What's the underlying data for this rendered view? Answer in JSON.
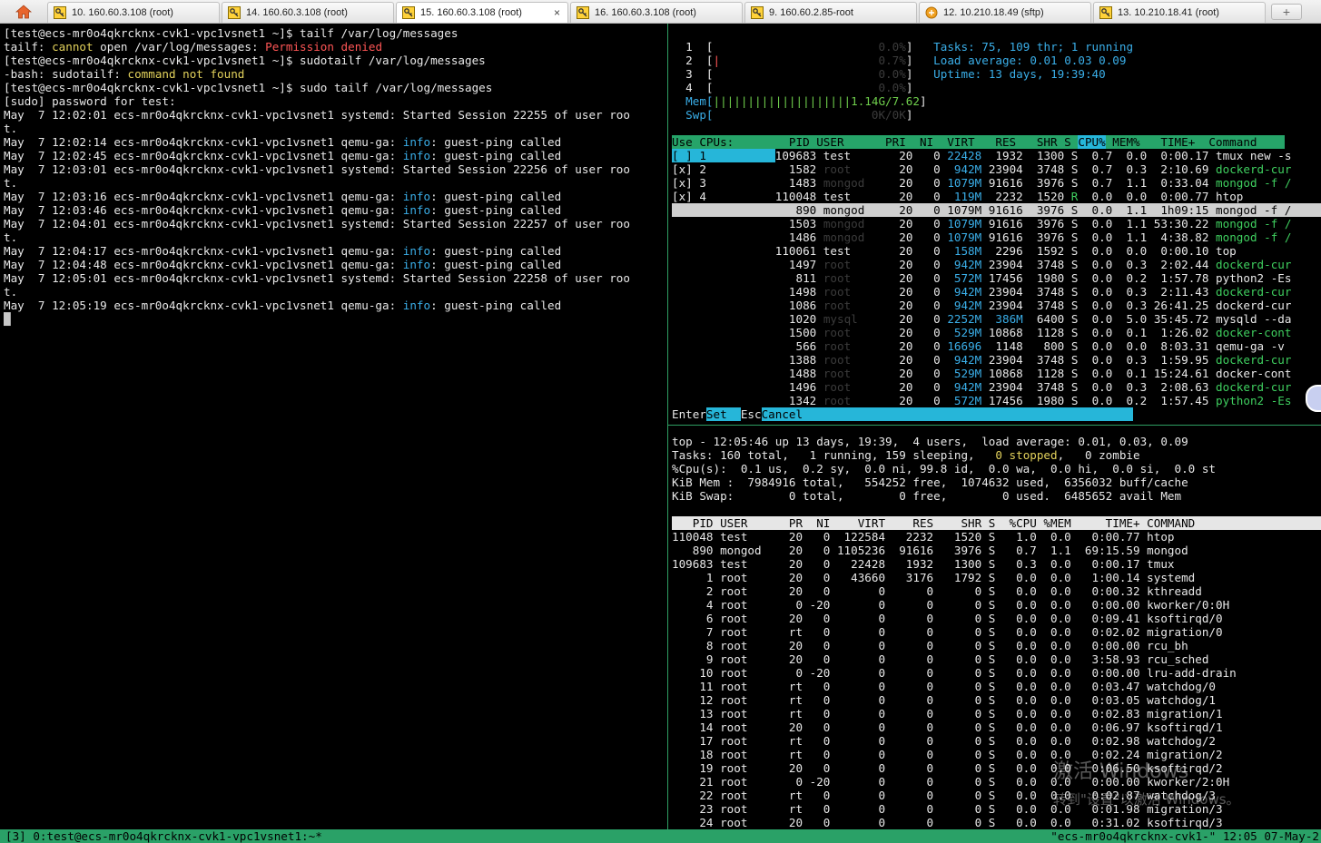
{
  "tabs": [
    {
      "label": "10. 160.60.3.108 (root)",
      "icon": "key-icon",
      "active": false
    },
    {
      "label": "14. 160.60.3.108 (root)",
      "icon": "key-icon",
      "active": false
    },
    {
      "label": "15. 160.60.3.108 (root)",
      "icon": "key-icon",
      "active": true
    },
    {
      "label": "16. 160.60.3.108 (root)",
      "icon": "key-icon",
      "active": false
    },
    {
      "label": "9. 160.60.2.85-root",
      "icon": "key-icon",
      "active": false
    },
    {
      "label": "12. 10.210.18.49 (sftp)",
      "icon": "sftp-icon",
      "active": false
    },
    {
      "label": "13. 10.210.18.41 (root)",
      "icon": "key-icon",
      "active": false
    }
  ],
  "tab_close": "×",
  "new_tab": "+",
  "left_pane": [
    [
      [
        "[test@ecs-mr0o4qkrcknx-cvk1-vpc1vsnet1 ~]$ tailf /var/log/messages",
        ""
      ]
    ],
    [
      [
        "tailf: ",
        ""
      ],
      [
        "cannot",
        "y"
      ],
      [
        " open /var/log/messages: ",
        ""
      ],
      [
        "Permission denied",
        "r"
      ]
    ],
    [
      [
        "[test@ecs-mr0o4qkrcknx-cvk1-vpc1vsnet1 ~]$ sudotailf /var/log/messages",
        ""
      ]
    ],
    [
      [
        "-bash: sudotailf: ",
        ""
      ],
      [
        "command not found",
        "y"
      ]
    ],
    [
      [
        "[test@ecs-mr0o4qkrcknx-cvk1-vpc1vsnet1 ~]$ sudo tailf /var/log/messages",
        ""
      ]
    ],
    [
      [
        "[sudo] password for test:",
        ""
      ]
    ],
    [
      [
        "May  7 12:02:01 ecs-mr0o4qkrcknx-cvk1-vpc1vsnet1 systemd: Started Session 22255 of user roo",
        ""
      ]
    ],
    [
      [
        "t.",
        ""
      ]
    ],
    [
      [
        "May  7 12:02:14 ecs-mr0o4qkrcknx-cvk1-vpc1vsnet1 qemu-ga: ",
        ""
      ],
      [
        "info",
        "c"
      ],
      [
        ": guest-ping called",
        ""
      ]
    ],
    [
      [
        "May  7 12:02:45 ecs-mr0o4qkrcknx-cvk1-vpc1vsnet1 qemu-ga: ",
        ""
      ],
      [
        "info",
        "c"
      ],
      [
        ": guest-ping called",
        ""
      ]
    ],
    [
      [
        "May  7 12:03:01 ecs-mr0o4qkrcknx-cvk1-vpc1vsnet1 systemd: Started Session 22256 of user roo",
        ""
      ]
    ],
    [
      [
        "t.",
        ""
      ]
    ],
    [
      [
        "May  7 12:03:16 ecs-mr0o4qkrcknx-cvk1-vpc1vsnet1 qemu-ga: ",
        ""
      ],
      [
        "info",
        "c"
      ],
      [
        ": guest-ping called",
        ""
      ]
    ],
    [
      [
        "May  7 12:03:46 ecs-mr0o4qkrcknx-cvk1-vpc1vsnet1 qemu-ga: ",
        ""
      ],
      [
        "info",
        "c"
      ],
      [
        ": guest-ping called",
        ""
      ]
    ],
    [
      [
        "May  7 12:04:01 ecs-mr0o4qkrcknx-cvk1-vpc1vsnet1 systemd: Started Session 22257 of user roo",
        ""
      ]
    ],
    [
      [
        "t.",
        ""
      ]
    ],
    [
      [
        "May  7 12:04:17 ecs-mr0o4qkrcknx-cvk1-vpc1vsnet1 qemu-ga: ",
        ""
      ],
      [
        "info",
        "c"
      ],
      [
        ": guest-ping called",
        ""
      ]
    ],
    [
      [
        "May  7 12:04:48 ecs-mr0o4qkrcknx-cvk1-vpc1vsnet1 qemu-ga: ",
        ""
      ],
      [
        "info",
        "c"
      ],
      [
        ": guest-ping called",
        ""
      ]
    ],
    [
      [
        "May  7 12:05:01 ecs-mr0o4qkrcknx-cvk1-vpc1vsnet1 systemd: Started Session 22258 of user roo",
        ""
      ]
    ],
    [
      [
        "t.",
        ""
      ]
    ],
    [
      [
        "May  7 12:05:19 ecs-mr0o4qkrcknx-cvk1-vpc1vsnet1 qemu-ga: ",
        ""
      ],
      [
        "info",
        "c"
      ],
      [
        ": guest-ping called",
        ""
      ]
    ],
    [
      [
        "█",
        "dg2"
      ]
    ]
  ],
  "htop_pane": [
    [
      [
        "  1  [",
        ""
      ],
      [
        "                        0.0%",
        "dg"
      ],
      [
        "]   ",
        ""
      ],
      [
        "Tasks: ",
        "c"
      ],
      [
        "75",
        "c"
      ],
      [
        ", 109 thr; 1 running",
        "c"
      ]
    ],
    [
      [
        "  2  [",
        ""
      ],
      [
        "|",
        "r"
      ],
      [
        "                       0.7%",
        "dg"
      ],
      [
        "]   ",
        ""
      ],
      [
        "Load average: ",
        "c"
      ],
      [
        "0.01 0.03 0.09",
        "c"
      ]
    ],
    [
      [
        "  3  [",
        ""
      ],
      [
        "                        0.0%",
        "dg"
      ],
      [
        "]   ",
        ""
      ],
      [
        "Uptime: ",
        "c"
      ],
      [
        "13 days, 19:39:40",
        "c"
      ]
    ],
    [
      [
        "  4  [",
        ""
      ],
      [
        "                        0.0%",
        "dg"
      ],
      [
        "]",
        ""
      ]
    ],
    [
      [
        "  Mem[",
        "c"
      ],
      [
        "||||||||||||||||||||1.14G/7.62",
        "g"
      ],
      [
        "]",
        ""
      ]
    ],
    [
      [
        "  Swp[",
        "c"
      ],
      [
        "                       0K/0K",
        "dg"
      ],
      [
        "]",
        ""
      ]
    ],
    [
      [
        "",
        ""
      ]
    ],
    [
      [
        "Use CPUs:      ",
        "hdr"
      ],
      [
        "  PID USER      PRI  NI  VIRT   RES   SHR S ",
        "hdr"
      ],
      [
        "CPU%",
        "cyanbar"
      ],
      [
        " MEM%   TIME+  Command    ",
        "hdr"
      ]
    ],
    [
      [
        "[ ] 1          ",
        "cyanbar"
      ],
      [
        "109683 test       20   0 ",
        ""
      ],
      [
        "22428",
        "c"
      ],
      [
        "  1932  1300 S  0.7  0.0  0:00.17 tmux new -s",
        ""
      ]
    ],
    [
      [
        "[x] 2            ",
        ""
      ],
      [
        "1582 ",
        ""
      ],
      [
        "root     ",
        "dg"
      ],
      [
        "  20   0  ",
        ""
      ],
      [
        "942M",
        "c"
      ],
      [
        " 23904  3748 S  0.7  0.3  2:10.69 ",
        ""
      ],
      [
        "dockerd-cur",
        "gg"
      ]
    ],
    [
      [
        "[x] 3            ",
        ""
      ],
      [
        "1483 ",
        ""
      ],
      [
        "mongod   ",
        "dg"
      ],
      [
        "  20   0 ",
        ""
      ],
      [
        "1079M",
        "c"
      ],
      [
        " 91616  3976 S  0.7  1.1  0:33.04 ",
        ""
      ],
      [
        "mongod -f /",
        "gg"
      ]
    ],
    [
      [
        "[x] 4          ",
        ""
      ],
      [
        "110048 test       20   0  ",
        ""
      ],
      [
        "119M",
        "c"
      ],
      [
        "  2232  1520 ",
        ""
      ],
      [
        "R",
        "gg"
      ],
      [
        "  0.0  0.0  0:00.77 htop",
        ""
      ]
    ],
    [
      [
        "               ",
        ""
      ],
      [
        "   890 mongod     20   0 1079M 91616  3976 S  0.0  1.1  1h09:15 mongod -f /",
        "sel"
      ]
    ],
    [
      [
        "                 ",
        ""
      ],
      [
        "1503 ",
        ""
      ],
      [
        "mongod   ",
        "dg"
      ],
      [
        "  20   0 ",
        ""
      ],
      [
        "1079M",
        "c"
      ],
      [
        " 91616  3976 S  0.0  1.1 53:30.22 ",
        ""
      ],
      [
        "mongod -f /",
        "gg"
      ]
    ],
    [
      [
        "                 ",
        ""
      ],
      [
        "1486 ",
        ""
      ],
      [
        "mongod   ",
        "dg"
      ],
      [
        "  20   0 ",
        ""
      ],
      [
        "1079M",
        "c"
      ],
      [
        " 91616  3976 S  0.0  1.1  4:38.82 ",
        ""
      ],
      [
        "mongod -f /",
        "gg"
      ]
    ],
    [
      [
        "               ",
        ""
      ],
      [
        "110061 test       20   0  ",
        ""
      ],
      [
        "158M",
        "c"
      ],
      [
        "  2296  1592 S  0.0  0.0  0:00.10 top",
        ""
      ]
    ],
    [
      [
        "                 ",
        ""
      ],
      [
        "1497 ",
        ""
      ],
      [
        "root     ",
        "dg"
      ],
      [
        "  20   0  ",
        ""
      ],
      [
        "942M",
        "c"
      ],
      [
        " 23904  3748 S  0.0  0.3  2:02.44 ",
        ""
      ],
      [
        "dockerd-cur",
        "gg"
      ]
    ],
    [
      [
        "                  ",
        ""
      ],
      [
        "811 ",
        ""
      ],
      [
        "root     ",
        "dg"
      ],
      [
        "  20   0  ",
        ""
      ],
      [
        "572M",
        "c"
      ],
      [
        " 17456  1980 S  0.0  0.2  1:57.78 python2 -Es",
        ""
      ]
    ],
    [
      [
        "                 ",
        ""
      ],
      [
        "1498 ",
        ""
      ],
      [
        "root     ",
        "dg"
      ],
      [
        "  20   0  ",
        ""
      ],
      [
        "942M",
        "c"
      ],
      [
        " 23904  3748 S  0.0  0.3  2:11.43 ",
        ""
      ],
      [
        "dockerd-cur",
        "gg"
      ]
    ],
    [
      [
        "                 ",
        ""
      ],
      [
        "1086 ",
        ""
      ],
      [
        "root     ",
        "dg"
      ],
      [
        "  20   0  ",
        ""
      ],
      [
        "942M",
        "c"
      ],
      [
        " 23904  3748 S  0.0  0.3 26:41.25 dockerd-cur",
        ""
      ]
    ],
    [
      [
        "                 ",
        ""
      ],
      [
        "1020 ",
        ""
      ],
      [
        "mysql    ",
        "dg"
      ],
      [
        "  20   0 ",
        ""
      ],
      [
        "2252M",
        "c"
      ],
      [
        "  ",
        ""
      ],
      [
        "386M",
        "c"
      ],
      [
        "  6400 S  0.0  5.0 35:45.72 mysqld --da",
        ""
      ]
    ],
    [
      [
        "                 ",
        ""
      ],
      [
        "1500 ",
        ""
      ],
      [
        "root     ",
        "dg"
      ],
      [
        "  20   0  ",
        ""
      ],
      [
        "529M",
        "c"
      ],
      [
        " 10868  1128 S  0.0  0.1  1:26.02 ",
        ""
      ],
      [
        "docker-cont",
        "gg"
      ]
    ],
    [
      [
        "                  ",
        ""
      ],
      [
        "566 ",
        ""
      ],
      [
        "root     ",
        "dg"
      ],
      [
        "  20   0 ",
        ""
      ],
      [
        "16696",
        "c"
      ],
      [
        "  1148   800 S  0.0  0.0  8:03.31 qemu-ga -v ",
        ""
      ]
    ],
    [
      [
        "                 ",
        ""
      ],
      [
        "1388 ",
        ""
      ],
      [
        "root     ",
        "dg"
      ],
      [
        "  20   0  ",
        ""
      ],
      [
        "942M",
        "c"
      ],
      [
        " 23904  3748 S  0.0  0.3  1:59.95 ",
        ""
      ],
      [
        "dockerd-cur",
        "gg"
      ]
    ],
    [
      [
        "                 ",
        ""
      ],
      [
        "1488 ",
        ""
      ],
      [
        "root     ",
        "dg"
      ],
      [
        "  20   0  ",
        ""
      ],
      [
        "529M",
        "c"
      ],
      [
        " 10868  1128 S  0.0  0.1 15:24.61 docker-cont",
        ""
      ]
    ],
    [
      [
        "                 ",
        ""
      ],
      [
        "1496 ",
        ""
      ],
      [
        "root     ",
        "dg"
      ],
      [
        "  20   0  ",
        ""
      ],
      [
        "942M",
        "c"
      ],
      [
        " 23904  3748 S  0.0  0.3  2:08.63 ",
        ""
      ],
      [
        "dockerd-cur",
        "gg"
      ]
    ],
    [
      [
        "                 ",
        ""
      ],
      [
        "1342 ",
        ""
      ],
      [
        "root     ",
        "dg"
      ],
      [
        "  20   0  ",
        ""
      ],
      [
        "572M",
        "c"
      ],
      [
        " 17456  1980 S  0.0  0.2  1:57.45 ",
        ""
      ],
      [
        "python2 -Es",
        "gg"
      ]
    ],
    [
      [
        "Enter",
        ""
      ],
      [
        "Set  ",
        "cyanbar"
      ],
      [
        "Esc",
        ""
      ],
      [
        "Cancel                                                ",
        "cyanbar"
      ]
    ]
  ],
  "top_pane": [
    [
      [
        "top - 12:05:46 up 13 days, 19:39,  4 users,  load average: 0.01, 0.03, 0.09",
        ""
      ]
    ],
    [
      [
        "Tasks: 160 total,   1 running, 159 sleeping,   ",
        ""
      ],
      [
        "0 stopped",
        "y"
      ],
      [
        ",   0 zombie",
        ""
      ]
    ],
    [
      [
        "%Cpu(s):  0.1 us,  0.2 sy,  0.0 ni, 99.8 id,  0.0 wa,  0.0 hi,  0.0 si,  0.0 st",
        ""
      ]
    ],
    [
      [
        "KiB Mem :  7984916 total,   554252 free,  1074632 used,  6356032 buff/cache",
        ""
      ]
    ],
    [
      [
        "KiB Swap:        0 total,        0 free,        0 used.  6485652 avail Mem",
        ""
      ]
    ],
    [
      [
        "",
        ""
      ]
    ],
    [
      [
        "   PID USER      PR  NI    VIRT    RES    SHR S  %CPU %MEM     TIME+ COMMAND     ",
        "hdrw"
      ]
    ],
    [
      [
        "110048 test      20   0  122584   2232   1520 S   1.0  0.0   0:00.77 htop",
        ""
      ]
    ],
    [
      [
        "   890 mongod    20   0 1105236  91616   3976 S   0.7  1.1  69:15.59 mongod",
        ""
      ]
    ],
    [
      [
        "109683 test      20   0   22428   1932   1300 S   0.3  0.0   0:00.17 tmux",
        ""
      ]
    ],
    [
      [
        "     1 root      20   0   43660   3176   1792 S   0.0  0.0   1:00.14 systemd",
        ""
      ]
    ],
    [
      [
        "     2 root      20   0       0      0      0 S   0.0  0.0   0:00.32 kthreadd",
        ""
      ]
    ],
    [
      [
        "     4 root       0 -20       0      0      0 S   0.0  0.0   0:00.00 kworker/0:0H",
        ""
      ]
    ],
    [
      [
        "     6 root      20   0       0      0      0 S   0.0  0.0   0:09.41 ksoftirqd/0",
        ""
      ]
    ],
    [
      [
        "     7 root      rt   0       0      0      0 S   0.0  0.0   0:02.02 migration/0",
        ""
      ]
    ],
    [
      [
        "     8 root      20   0       0      0      0 S   0.0  0.0   0:00.00 rcu_bh",
        ""
      ]
    ],
    [
      [
        "     9 root      20   0       0      0      0 S   0.0  0.0   3:58.93 rcu_sched",
        ""
      ]
    ],
    [
      [
        "    10 root       0 -20       0      0      0 S   0.0  0.0   0:00.00 lru-add-drain",
        ""
      ]
    ],
    [
      [
        "    11 root      rt   0       0      0      0 S   0.0  0.0   0:03.47 watchdog/0",
        ""
      ]
    ],
    [
      [
        "    12 root      rt   0       0      0      0 S   0.0  0.0   0:03.05 watchdog/1",
        ""
      ]
    ],
    [
      [
        "    13 root      rt   0       0      0      0 S   0.0  0.0   0:02.83 migration/1",
        ""
      ]
    ],
    [
      [
        "    14 root      20   0       0      0      0 S   0.0  0.0   0:06.97 ksoftirqd/1",
        ""
      ]
    ],
    [
      [
        "    17 root      rt   0       0      0      0 S   0.0  0.0   0:02.98 watchdog/2",
        ""
      ]
    ],
    [
      [
        "    18 root      rt   0       0      0      0 S   0.0  0.0   0:02.24 migration/2",
        ""
      ]
    ],
    [
      [
        "    19 root      20   0       0      0      0 S   0.0  0.0   0:06.50 ksoftirqd/2",
        ""
      ]
    ],
    [
      [
        "    21 root       0 -20       0      0      0 S   0.0  0.0   0:00.00 kworker/2:0H",
        ""
      ]
    ],
    [
      [
        "    22 root      rt   0       0      0      0 S   0.0  0.0   0:02.87 watchdog/3",
        ""
      ]
    ],
    [
      [
        "    23 root      rt   0       0      0      0 S   0.0  0.0   0:01.98 migration/3",
        ""
      ]
    ],
    [
      [
        "    24 root      20   0       0      0      0 S   0.0  0.0   0:31.02 ksoftirqd/3",
        ""
      ]
    ]
  ],
  "status_bar": {
    "left": "[3] 0:test@ecs-mr0o4qkrcknx-cvk1-vpc1vsnet1:~*",
    "right": "\"ecs-mr0o4qkrcknx-cvk1-\" 12:05 07-May-2"
  },
  "watermark": {
    "line1": "激活 Windows",
    "line2": "转到\"设置\"以激活 Windows。"
  },
  "colors": {
    "tmux_green": "#2aa167",
    "htop_header": "#26a469",
    "htop_cyan": "#26b6d9",
    "info_blue": "#3aaee8",
    "warn_yellow": "#e3d25c",
    "error_red": "#ff5656"
  }
}
